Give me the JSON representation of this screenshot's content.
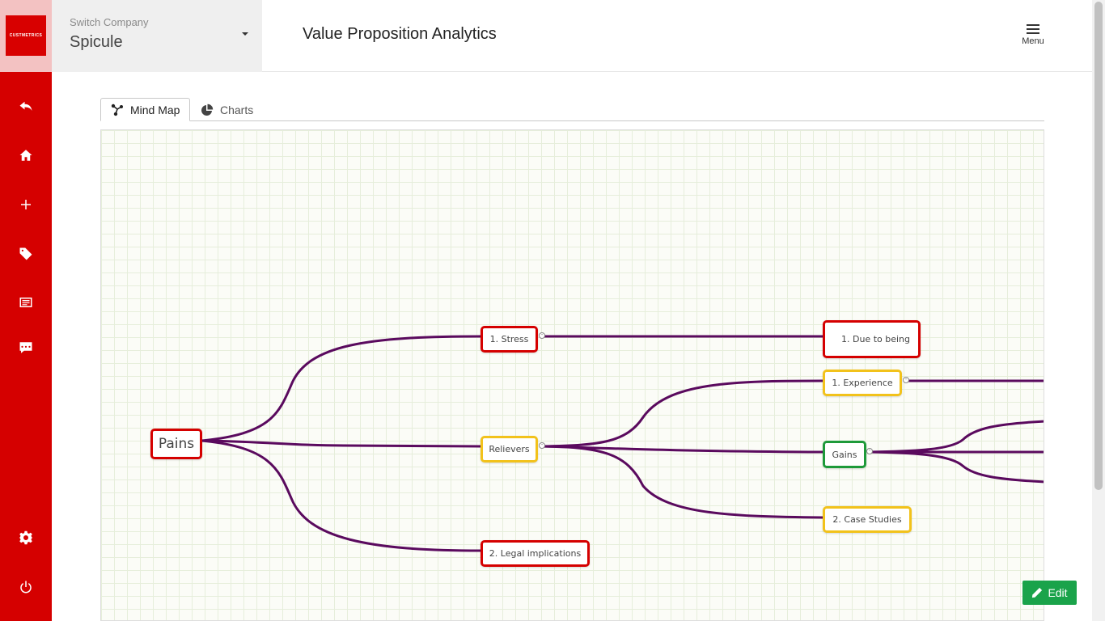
{
  "brand": {
    "logo_text": "CUSTMETRICS",
    "accent": "#d50000"
  },
  "company": {
    "label": "Switch Company",
    "name": "Spicule"
  },
  "header": {
    "title": "Value Proposition Analytics",
    "menu_label": "Menu"
  },
  "sidebar": {
    "items": [
      {
        "icon": "back-icon"
      },
      {
        "icon": "home-icon"
      },
      {
        "icon": "plus-icon"
      },
      {
        "icon": "tag-icon"
      },
      {
        "icon": "newspaper-icon"
      },
      {
        "icon": "comment-icon"
      },
      {
        "icon": "gear-icon"
      },
      {
        "icon": "power-icon"
      }
    ]
  },
  "tabs": [
    {
      "label": "Mind Map",
      "icon": "sitemap-icon",
      "active": true
    },
    {
      "label": "Charts",
      "icon": "pie-chart-icon",
      "active": false
    }
  ],
  "mindmap": {
    "nodes": {
      "pains": "Pains",
      "stress": "1. Stress",
      "relievers": "Relievers",
      "legal": "2. Legal implications",
      "due": "1. Due to being",
      "experience": "1. Experience",
      "gains": "Gains",
      "case": "2. Case Studies"
    },
    "colors": {
      "link": "#5a0a5e",
      "red": "#d50000",
      "yellow": "#f2c21b",
      "green": "#1e9a3a"
    }
  },
  "actions": {
    "edit_label": "Edit"
  }
}
